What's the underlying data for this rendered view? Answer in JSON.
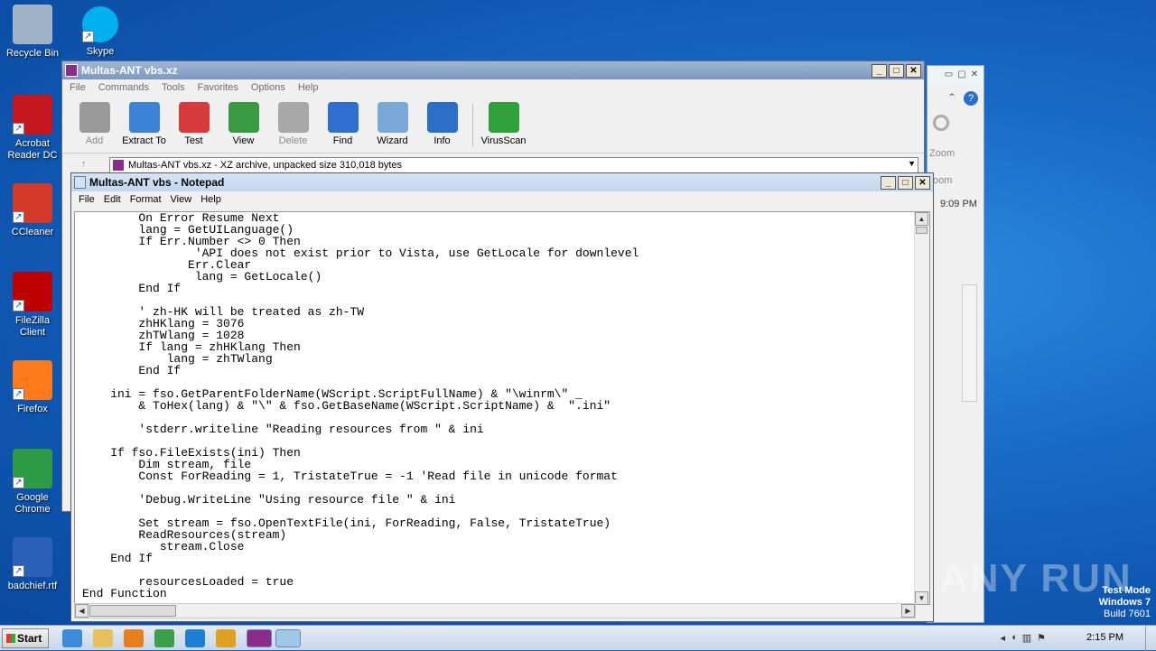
{
  "desktop": {
    "icons": [
      {
        "label": "Recycle Bin",
        "color": "#9fb3c9"
      },
      {
        "label": "Skype",
        "color": "#00aff0"
      },
      {
        "label": "Acrobat Reader DC",
        "color": "#c4161c"
      },
      {
        "label": "CCleaner",
        "color": "#d43a2a"
      },
      {
        "label": "FileZilla Client",
        "color": "#bf0000"
      },
      {
        "label": "Firefox",
        "color": "#ff7a1a"
      },
      {
        "label": "Google Chrome",
        "color": "#2e9b46"
      },
      {
        "label": "badchief.rtf",
        "color": "#2b5fb8"
      }
    ]
  },
  "bgwindow": {
    "zoom_label": "Zoom",
    "zoom_label2": "oom",
    "time_text": "9:09 PM"
  },
  "winrar": {
    "title": "Multas-ANT vbs.xz",
    "menu": [
      "File",
      "Commands",
      "Tools",
      "Favorites",
      "Options",
      "Help"
    ],
    "toolbar": [
      {
        "label": "Add",
        "color": "#9a9a9a",
        "disabled": true
      },
      {
        "label": "Extract To",
        "color": "#3a83d6",
        "disabled": false
      },
      {
        "label": "Test",
        "color": "#d63a3a",
        "disabled": false
      },
      {
        "label": "View",
        "color": "#3a9a44",
        "disabled": false
      },
      {
        "label": "Delete",
        "color": "#a8a8a8",
        "disabled": true
      },
      {
        "label": "Find",
        "color": "#2f6fd0",
        "disabled": false
      },
      {
        "label": "Wizard",
        "color": "#7aa8d6",
        "disabled": false
      },
      {
        "label": "Info",
        "color": "#2a6fc9",
        "disabled": false
      },
      {
        "label": "VirusScan",
        "color": "#2fa03a",
        "disabled": false
      }
    ],
    "address": "Multas-ANT vbs.xz - XZ archive, unpacked size 310,018 bytes"
  },
  "notepad": {
    "title": "Multas-ANT vbs - Notepad",
    "menu": [
      "File",
      "Edit",
      "Format",
      "View",
      "Help"
    ],
    "lines": [
      "        On Error Resume Next",
      "        lang = GetUILanguage()",
      "        If Err.Number <> 0 Then",
      "                'API does not exist prior to Vista, use GetLocale for downlevel",
      "               Err.Clear",
      "                lang = GetLocale()",
      "        End If",
      "",
      "        ' zh-HK will be treated as zh-TW",
      "        zhHKlang = 3076",
      "        zhTWlang = 1028",
      "        If lang = zhHKlang Then",
      "            lang = zhTWlang",
      "        End If",
      "",
      "    ini = fso.GetParentFolderName(WScript.ScriptFullName) & \"\\winrm\\\" _",
      "        & ToHex(lang) & \"\\\" & fso.GetBaseName(WScript.ScriptName) &  \".ini\"",
      "",
      "        'stderr.writeline \"Reading resources from \" & ini",
      "",
      "    If fso.FileExists(ini) Then",
      "        Dim stream, file",
      "        Const ForReading = 1, TristateTrue = -1 'Read file in unicode format",
      "",
      "        'Debug.WriteLine \"Using resource file \" & ini",
      "",
      "        Set stream = fso.OpenTextFile(ini, ForReading, False, TristateTrue)",
      "        ReadResources(stream)",
      "           stream.Close",
      "    End If",
      "",
      "        resourcesLoaded = true",
      "End Function"
    ]
  },
  "taskbar": {
    "start_label": "Start",
    "apps": [
      {
        "name": "internet-explorer",
        "color": "#3b8bd8"
      },
      {
        "name": "file-explorer",
        "color": "#e8c05a"
      },
      {
        "name": "media-player",
        "color": "#e87e1c"
      },
      {
        "name": "chrome",
        "color": "#3aa14a"
      },
      {
        "name": "edge",
        "color": "#1d7fd4"
      },
      {
        "name": "outlook",
        "color": "#e0a020"
      },
      {
        "name": "winrar",
        "color": "#8a2d8a"
      },
      {
        "name": "notepad",
        "color": "#9fc7e8"
      }
    ],
    "clock": "2:15 PM"
  },
  "watermark": {
    "line1": "Test Mode",
    "line2": "Windows 7",
    "line3": "Build 7601",
    "brand": "ANY RUN"
  }
}
